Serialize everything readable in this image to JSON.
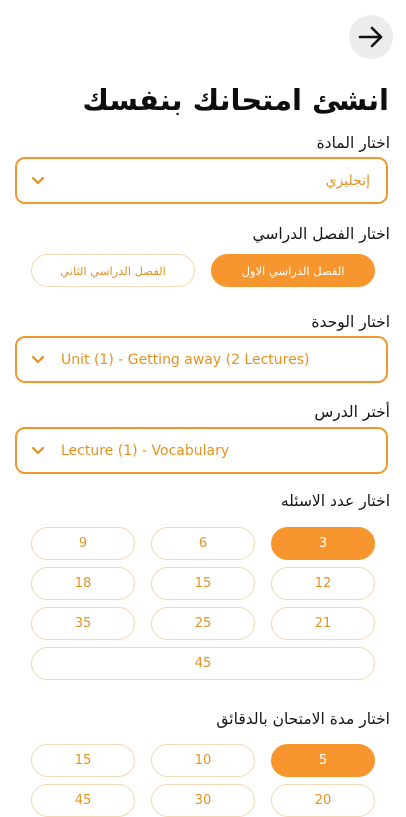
{
  "header": {
    "title": "انشئ امتحانك بنفسك",
    "back_icon": "arrow-right-icon"
  },
  "colors": {
    "accent": "#f7962f",
    "accent_text": "#e6911f",
    "chip_border": "#f2d8b4"
  },
  "subject": {
    "label": "اختار المادة",
    "value": "إنجليزي"
  },
  "semester": {
    "label": "اختار الفصل الدراسي",
    "options": [
      {
        "label": "الفصل الدراسي الاول",
        "selected": true
      },
      {
        "label": "الفصل الدراسي الثاني",
        "selected": false
      }
    ]
  },
  "unit": {
    "label": "اختار الوحدة",
    "value": "Unit (1) - Getting away (2 Lectures)"
  },
  "lesson": {
    "label": "أختر الدرس",
    "value": "Lecture (1) - Vocabulary"
  },
  "question_count": {
    "label": "اختار عدد الاسئله",
    "options": [
      "3",
      "6",
      "9",
      "12",
      "15",
      "18",
      "21",
      "25",
      "35",
      "45"
    ],
    "selected": "3"
  },
  "duration": {
    "label": "اختار مدة الامتحان بالدقائق",
    "options": [
      "5",
      "10",
      "15",
      "20",
      "30",
      "45"
    ],
    "selected": "5"
  }
}
